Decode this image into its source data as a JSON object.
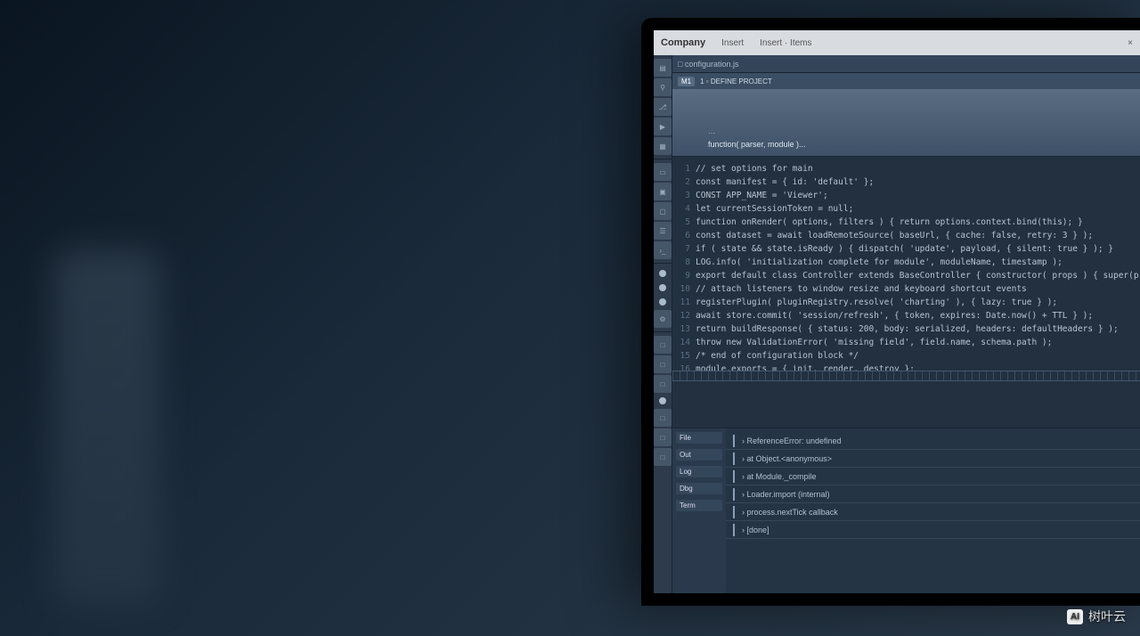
{
  "browser": {
    "logo": "Company",
    "menu1": "Insert",
    "menu2": "Insert · Items",
    "close": "×"
  },
  "tab": {
    "filename": "□ configuration.js"
  },
  "toolbar": {
    "badge": "M1",
    "text": "1 ▫ DEFINE PROJECT"
  },
  "preview": {
    "line1": "···",
    "line2": "function( parser, module )..."
  },
  "code": {
    "lines": [
      "// set options for main",
      "const manifest = { id: 'default' };",
      "CONST APP_NAME = 'Viewer';",
      "let  currentSessionToken = null;",
      "function onRender( options, filters ) { return options.context.bind(this); }",
      "const dataset = await loadRemoteSource( baseUrl, { cache: false, retry: 3 } );",
      "if ( state && state.isReady ) { dispatch( 'update', payload, { silent: true } ); }",
      "LOG.info( 'initialization complete for module', moduleName, timestamp );",
      "export default class Controller extends BaseController { constructor( props ) { super(props); } }",
      "// attach listeners to window resize and keyboard shortcut events",
      "registerPlugin( pluginRegistry.resolve( 'charting' ), { lazy: true } );",
      "await store.commit( 'session/refresh', { token, expires: Date.now() + TTL } );",
      "return buildResponse( { status: 200, body: serialized, headers: defaultHeaders } );",
      "throw new ValidationError( 'missing field', field.name, schema.path );",
      "/* end of configuration block */",
      "module.exports = { init, render, destroy };"
    ]
  },
  "panel": {
    "leftTabs": [
      "File",
      "Out",
      "Log",
      "Dbg",
      "Term"
    ],
    "rows": [
      "› ReferenceError: undefined",
      "› at Object.<anonymous>",
      "› at Module._compile",
      "› Loader.import (internal)",
      "› process.nextTick callback",
      "› [done]"
    ]
  },
  "watermark": {
    "badge": "AI",
    "text": "树叶云"
  }
}
